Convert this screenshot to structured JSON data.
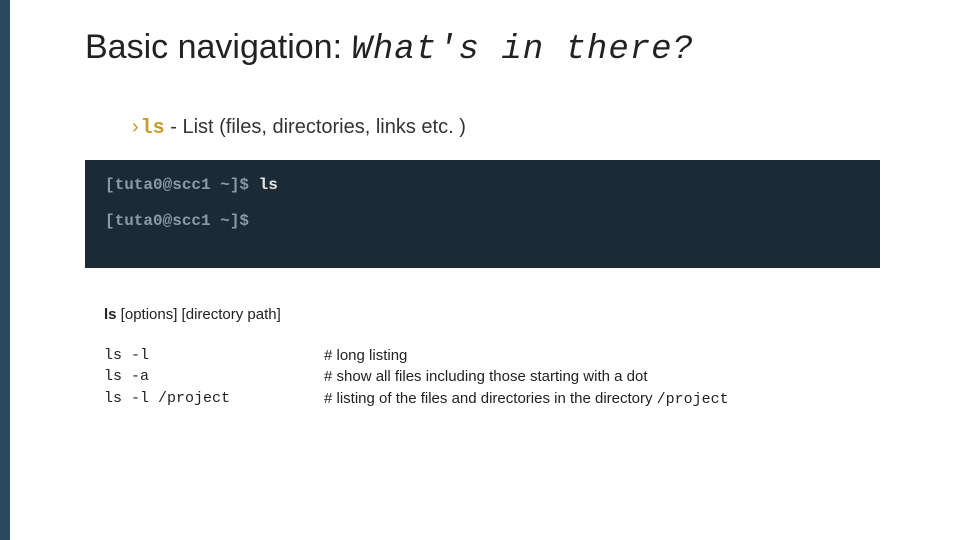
{
  "title": {
    "prefix": "Basic navigation: ",
    "suffix": "What's in there?"
  },
  "bullet": {
    "caret": "›",
    "cmd": "ls",
    "dash": " -  ",
    "desc": "List (files, directories, links etc. )"
  },
  "terminal": {
    "line1_prompt": "[tuta0@scc1 ~]$ ",
    "line1_cmd": "ls",
    "line2_prompt": "[tuta0@scc1 ~]$"
  },
  "syntax": {
    "bold": "ls",
    "rest": " [options] [directory path]"
  },
  "examples": [
    {
      "cmd": "ls -l",
      "comment_prefix": "# long listing",
      "comment_mono": ""
    },
    {
      "cmd": "ls -a",
      "comment_prefix": "# show all files including those starting with a dot",
      "comment_mono": ""
    },
    {
      "cmd": "ls -l /project",
      "comment_prefix": "# listing of the files and directories in the directory ",
      "comment_mono": "/project"
    }
  ]
}
